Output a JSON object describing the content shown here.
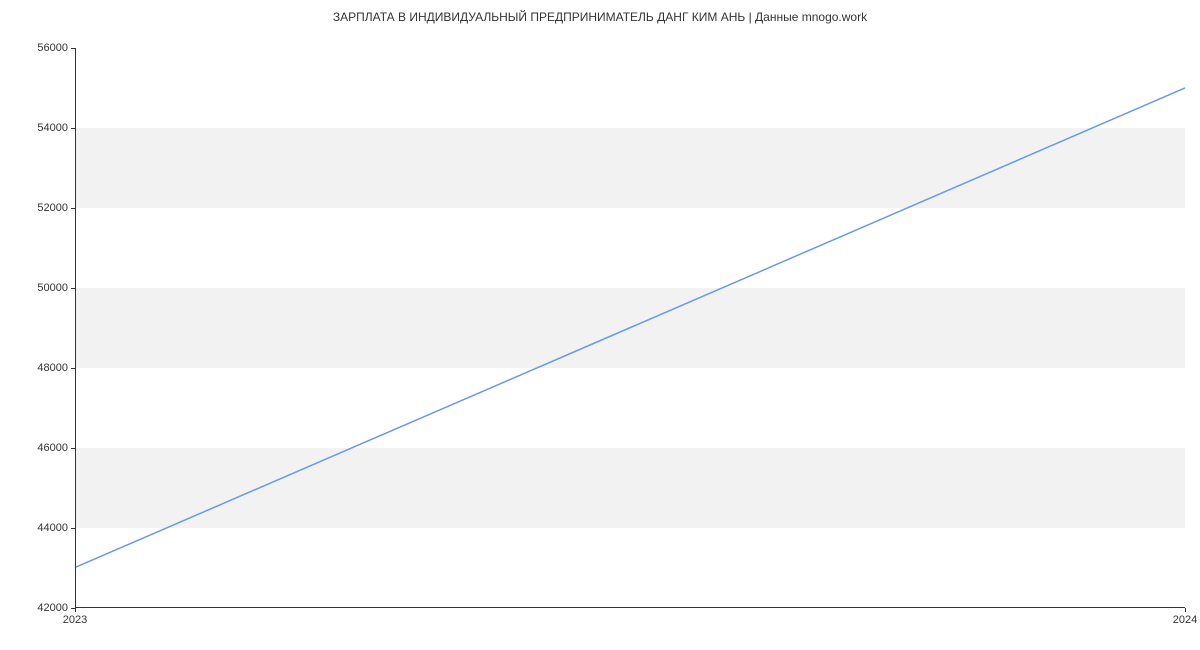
{
  "chart_data": {
    "type": "line",
    "title": "ЗАРПЛАТА В ИНДИВИДУАЛЬНЫЙ ПРЕДПРИНИМАТЕЛЬ ДАНГ КИМ АНЬ | Данные mnogo.work",
    "xlabel": "",
    "ylabel": "",
    "x": [
      2023,
      2024
    ],
    "values": [
      43000,
      55000
    ],
    "y_ticks": [
      42000,
      44000,
      46000,
      48000,
      50000,
      52000,
      54000,
      56000
    ],
    "x_ticks": [
      2023,
      2024
    ],
    "ylim": [
      42000,
      56000
    ],
    "xlim": [
      2023,
      2024
    ]
  }
}
